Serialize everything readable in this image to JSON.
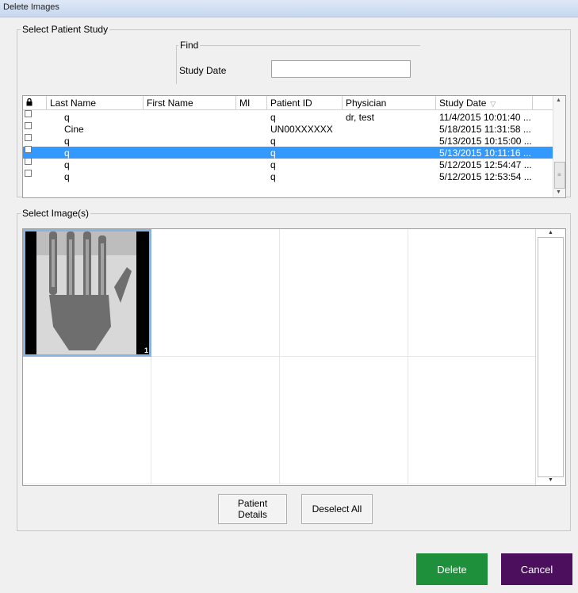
{
  "window": {
    "title": "Delete Images"
  },
  "study_group": {
    "legend": "Select Patient Study",
    "find": {
      "legend": "Find",
      "study_date_label": "Study Date",
      "study_date_value": "",
      "study_date_placeholder": ""
    },
    "columns": [
      "Last Name",
      "First Name",
      "MI",
      "Patient ID",
      "Physician",
      "Study Date"
    ],
    "sort_icon": "sort-descending-icon",
    "rows": [
      {
        "last": "q",
        "first": "",
        "mi": "",
        "pid": "q",
        "physician": "dr, test",
        "date": "11/4/2015 10:01:40 ...",
        "selected": false
      },
      {
        "last": "Cine",
        "first": "",
        "mi": "",
        "pid": "UN00XXXXXX",
        "physician": "",
        "date": "5/18/2015 11:31:58 ...",
        "selected": false
      },
      {
        "last": "q",
        "first": "",
        "mi": "",
        "pid": "q",
        "physician": "",
        "date": "5/13/2015 10:15:00 ...",
        "selected": false
      },
      {
        "last": "q",
        "first": "",
        "mi": "",
        "pid": "q",
        "physician": "",
        "date": "5/13/2015 10:11:16 ...",
        "selected": true
      },
      {
        "last": "q",
        "first": "",
        "mi": "",
        "pid": "q",
        "physician": "",
        "date": "5/12/2015 12:54:47 ...",
        "selected": false
      },
      {
        "last": "q",
        "first": "",
        "mi": "",
        "pid": "q",
        "physician": "",
        "date": "5/12/2015 12:53:54 ...",
        "selected": false
      }
    ]
  },
  "images_group": {
    "legend": "Select Image(s)",
    "thumbnails": [
      {
        "frame": "1",
        "selected": true,
        "content": "hand x-ray"
      }
    ],
    "patient_details_label": "Patient Details",
    "deselect_all_label": "Deselect All"
  },
  "actions": {
    "delete_label": "Delete",
    "cancel_label": "Cancel",
    "delete_color": "#1e8f3a",
    "cancel_color": "#4b0f5e"
  },
  "colors": {
    "selection": "#3399ff",
    "thumb_border": "#8cb3e0"
  }
}
